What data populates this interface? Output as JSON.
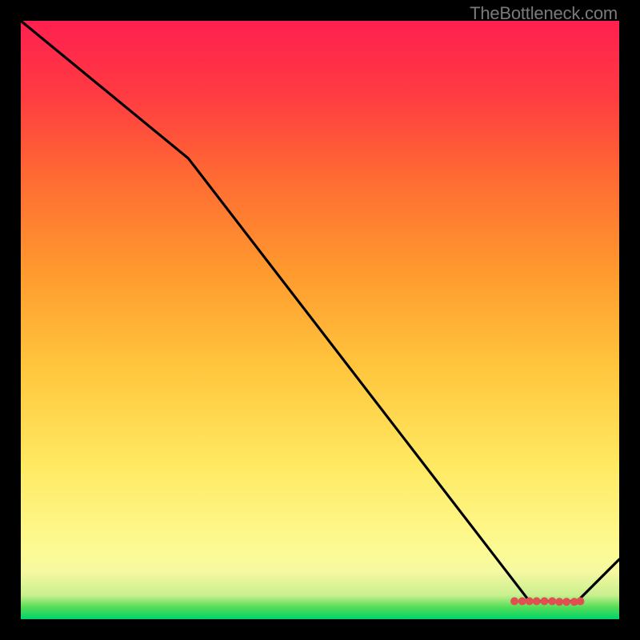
{
  "watermark": "TheBottleneck.com",
  "chart_data": {
    "type": "line",
    "title": "",
    "xlabel": "",
    "ylabel": "",
    "xlim": [
      0,
      100
    ],
    "ylim": [
      0,
      100
    ],
    "gradient_stops": [
      {
        "offset": "0%",
        "color": "#00d46a"
      },
      {
        "offset": "2%",
        "color": "#54dd57"
      },
      {
        "offset": "4%",
        "color": "#c9ef8f"
      },
      {
        "offset": "8%",
        "color": "#f6f9a1"
      },
      {
        "offset": "12%",
        "color": "#fdfa92"
      },
      {
        "offset": "26%",
        "color": "#ffe961"
      },
      {
        "offset": "42%",
        "color": "#ffc63d"
      },
      {
        "offset": "58%",
        "color": "#ff9a2e"
      },
      {
        "offset": "74%",
        "color": "#ff6a33"
      },
      {
        "offset": "88%",
        "color": "#ff3a42"
      },
      {
        "offset": "100%",
        "color": "#ff2050"
      }
    ],
    "series": [
      {
        "name": "curve",
        "color": "#000000",
        "x": [
          0,
          28,
          85,
          93,
          100
        ],
        "values": [
          100,
          77,
          3,
          3,
          10
        ]
      }
    ],
    "markers": {
      "name": "valley-dots",
      "color": "#e05050",
      "x": [
        82.5,
        83.8,
        85.0,
        86.2,
        87.5,
        88.8,
        90.0,
        91.2,
        92.5,
        93.5
      ],
      "values": [
        3.0,
        3.0,
        3.0,
        3.0,
        3.0,
        3.0,
        2.9,
        2.9,
        2.9,
        3.0
      ]
    }
  }
}
